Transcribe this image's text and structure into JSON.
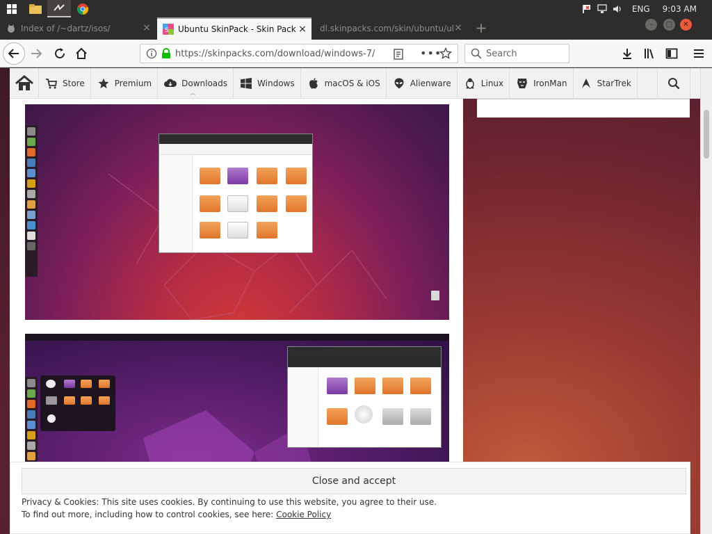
{
  "taskbar": {
    "apps": [
      "windows-start",
      "file-explorer",
      "skinpack-app",
      "chrome"
    ],
    "tray": {
      "language": "ENG",
      "time": "9:03 AM"
    }
  },
  "tabs": [
    {
      "title": "Index of /~dartz/isos/",
      "state": "inactive"
    },
    {
      "title": "Ubuntu SkinPack - Skin Pack Th",
      "state": "active"
    },
    {
      "title": "dl.skinpacks.com/skin/ubuntu/ul",
      "state": "inactive"
    }
  ],
  "navbar": {
    "url": "https://skinpacks.com/download/windows-7/",
    "search_placeholder": "Search"
  },
  "site_nav": {
    "items": [
      {
        "label": "Store",
        "icon": "cart-icon"
      },
      {
        "label": "Premium",
        "icon": "star-icon"
      },
      {
        "label": "Downloads",
        "icon": "cloud-download-icon"
      },
      {
        "label": "Windows",
        "icon": "windows-icon"
      },
      {
        "label": "macOS & iOS",
        "icon": "apple-icon"
      },
      {
        "label": "Alienware",
        "icon": "alien-icon"
      },
      {
        "label": "Linux",
        "icon": "tux-icon"
      },
      {
        "label": "IronMan",
        "icon": "ironman-icon"
      },
      {
        "label": "StarTrek",
        "icon": "startrek-icon"
      }
    ]
  },
  "cookie": {
    "accept_label": "Close and accept",
    "line1": "Privacy & Cookies: This site uses cookies. By continuing to use this website, you agree to their use.",
    "line2_prefix": "To find out more, including how to control cookies, see here:",
    "link_label": "Cookie Policy"
  },
  "colors": {
    "accent_close": "#e9593a",
    "banner_bg": "#ffffff",
    "wallpaper": "#6e2530"
  }
}
